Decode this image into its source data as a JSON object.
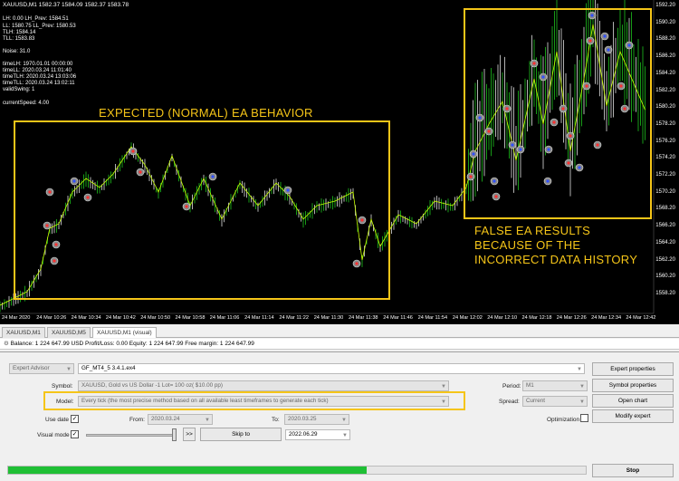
{
  "chart": {
    "title": "XAUUSD,M1  1582.37 1584.09 1582.37 1583.78",
    "info_lines": [
      "LH: 0.00      LH_Prev: 1584.51",
      "LL: 1580.75   LL_Prev: 1580.53",
      "TLH: 1584.14",
      "TLL: 1583.83",
      "",
      "Noise: 31.0",
      "",
      "timeLH: 1970.01.01 00:00:00",
      "timeLL: 2020.03.24 11:01:40",
      "timeTLH: 2020.03.24 13:03:06",
      "timeTLL: 2020.03.24 13:02:11",
      "validSwing: 1",
      "",
      "currentSpeed: 4.00"
    ],
    "annotation_expected": "EXPECTED (NORMAL) EA BEHAVIOR",
    "annotation_false": [
      "FALSE EA RESULTS",
      "BECAUSE OF THE",
      "INCORRECT DATA HISTORY"
    ],
    "price_labels": [
      "1592.20",
      "1590.20",
      "1588.20",
      "1586.20",
      "1584.20",
      "1582.20",
      "1580.20",
      "1578.20",
      "1576.20",
      "1574.20",
      "1572.20",
      "1570.20",
      "1568.20",
      "1566.20",
      "1564.20",
      "1562.20",
      "1560.20",
      "1558.20"
    ],
    "time_labels": [
      "24 Mar 2020",
      "24 Mar 10:26",
      "24 Mar 10:34",
      "24 Mar 10:42",
      "24 Mar 10:50",
      "24 Mar 10:58",
      "24 Mar 11:06",
      "24 Mar 11:14",
      "24 Mar 11:22",
      "24 Mar 11:30",
      "24 Mar 11:38",
      "24 Mar 11:46",
      "24 Mar 11:54",
      "24 Mar 12:02",
      "24 Mar 12:10",
      "24 Mar 12:18",
      "24 Mar 12:26",
      "24 Mar 12:34",
      "24 Mar 12:42"
    ],
    "colors": {
      "bull": "#22dd22",
      "bear": "#ffffff",
      "line": "#c8ff00",
      "annotation": "#f5c518"
    }
  },
  "tabs": [
    "XAUUSD,M1",
    "XAUUSD,M5",
    "XAUUSD,M1 (visual)"
  ],
  "balance_line": "Balance: 1 224 647.99 USD  Profit/Loss: 0.00  Equity: 1 224 647.99  Free margin: 1 224 647.99",
  "tester": {
    "mode": "Expert Advisor",
    "ea_file": "GF_MT4_5 3.4.1.ex4",
    "symbol_label": "Symbol:",
    "symbol_value": "XAUUSD, Gold vs US Dollar -1 Lot= 100 oz( $10.00 pp)",
    "period_label": "Period:",
    "period_value": "M1",
    "model_label": "Model:",
    "model_value": "Every tick (the most precise method based on all available least timeframes to generate each tick)",
    "spread_label": "Spread:",
    "spread_value": "Current",
    "use_date_label": "Use date",
    "from_label": "From:",
    "from_value": "2020.03.24",
    "to_label": "To:",
    "to_value": "2020.03.25",
    "optimization_label": "Optimization",
    "visual_mode_label": "Visual mode",
    "skip_to_label": "Skip to",
    "skip_date": "2022.06.29",
    "skip_fwd": ">>",
    "buttons": {
      "expert_properties": "Expert properties",
      "symbol_properties": "Symbol properties",
      "open_chart": "Open chart",
      "modify_expert": "Modify expert",
      "stop": "Stop"
    },
    "progress_fraction": 0.62,
    "progress_color": "#1fbf35"
  }
}
